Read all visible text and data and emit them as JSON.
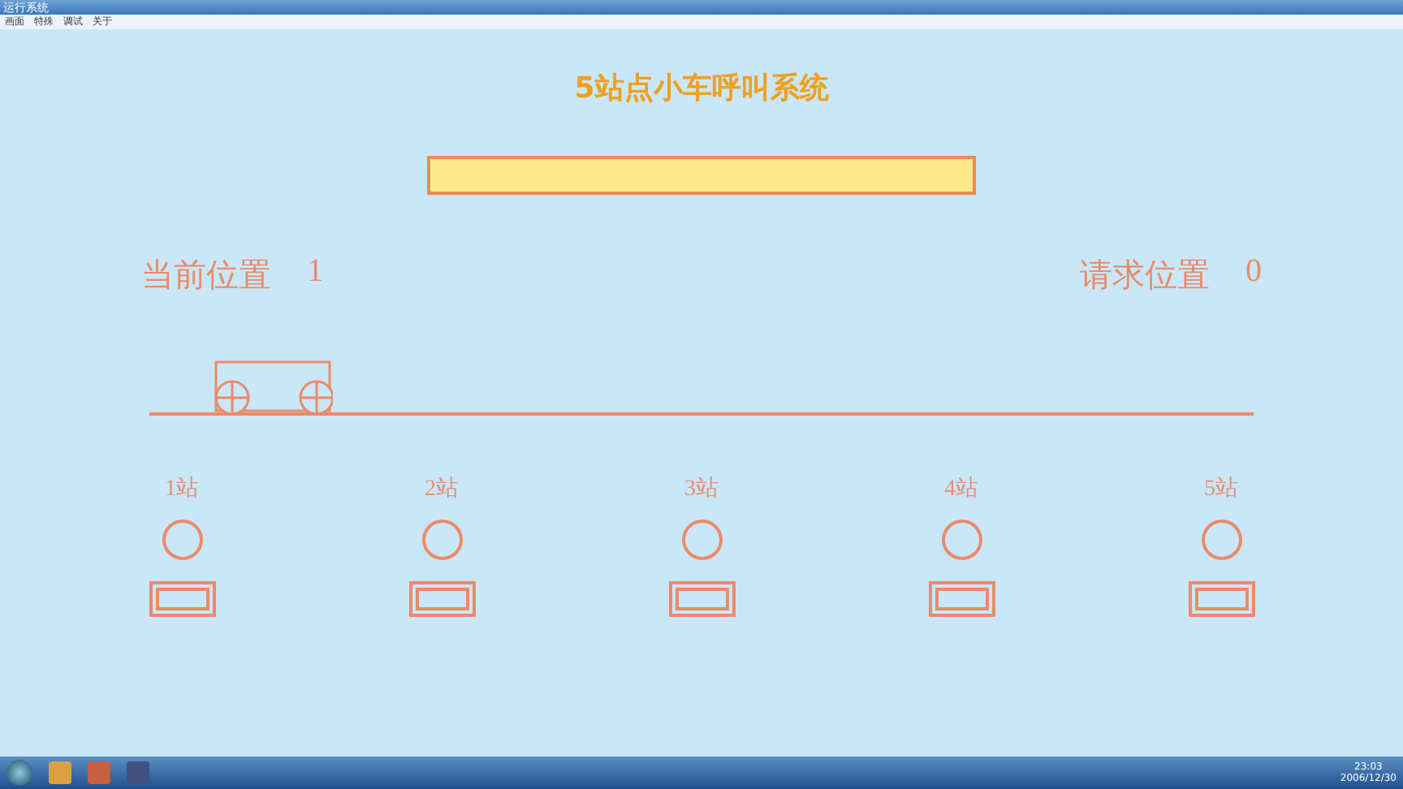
{
  "window": {
    "title": "运行系统"
  },
  "menu": [
    "画面",
    "特殊",
    "调试",
    "关于"
  ],
  "title": "5站点小车呼叫系统",
  "current_position": {
    "label": "当前位置",
    "value": "1"
  },
  "request_position": {
    "label": "请求位置",
    "value": "0"
  },
  "car": {
    "level": 0.08
  },
  "stations": [
    {
      "label": "1站",
      "lamp_on": false
    },
    {
      "label": "2站",
      "lamp_on": false
    },
    {
      "label": "3站",
      "lamp_on": false
    },
    {
      "label": "4站",
      "lamp_on": false
    },
    {
      "label": "5站",
      "lamp_on": false
    }
  ],
  "taskbar": {
    "time": "23:03",
    "date": "2006/12/30"
  }
}
